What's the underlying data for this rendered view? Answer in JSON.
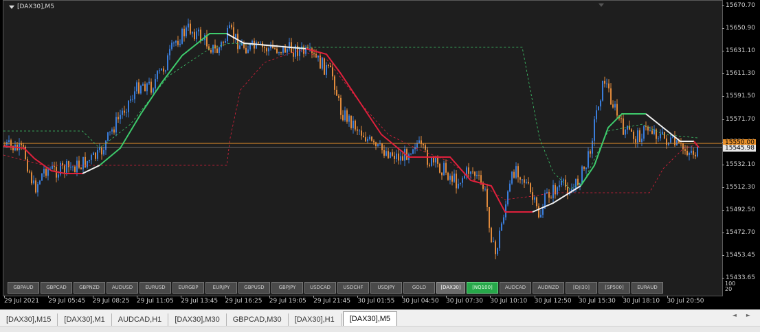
{
  "chart": {
    "symbol_label": "[DAX30],M5",
    "price_ticks": [
      "15670.70",
      "15650.90",
      "15631.10",
      "15611.30",
      "15591.50",
      "15571.70",
      "15551.90",
      "15532.10",
      "15512.30",
      "15492.50",
      "15472.70",
      "15453.45",
      "15433.65"
    ],
    "current_price": "15545.98",
    "orange_tag": "15550.00",
    "time_labels": [
      "29 Jul 2021",
      "29 Jul 05:45",
      "29 Jul 08:25",
      "29 Jul 11:05",
      "29 Jul 13:45",
      "29 Jul 16:25",
      "29 Jul 19:05",
      "29 Jul 21:45",
      "30 Jul 01:55",
      "30 Jul 04:50",
      "30 Jul 07:30",
      "30 Jul 10:10",
      "30 Jul 12:50",
      "30 Jul 15:30",
      "30 Jul 18:10",
      "30 Jul 20:50"
    ],
    "osc_levels": [
      "100",
      "20"
    ],
    "colors": {
      "background": "#1e1e1e",
      "bull_candle": "#3a7ddb",
      "bear_candle": "#e08a3c",
      "trend_up": "#3ecb6c",
      "trend_down": "#e0203c",
      "trend_flat": "#f0f0f0",
      "price_line": "#e8a040"
    }
  },
  "symbol_buttons": [
    {
      "label": "GBPAUD",
      "state": "normal"
    },
    {
      "label": "GBPCAD",
      "state": "normal"
    },
    {
      "label": "GBPNZD",
      "state": "normal"
    },
    {
      "label": "AUDUSD",
      "state": "normal"
    },
    {
      "label": "EURUSD",
      "state": "normal"
    },
    {
      "label": "EURGBP",
      "state": "normal"
    },
    {
      "label": "EURJPY",
      "state": "normal"
    },
    {
      "label": "GBPUSD",
      "state": "normal"
    },
    {
      "label": "GBPJPY",
      "state": "normal"
    },
    {
      "label": "USDCAD",
      "state": "normal"
    },
    {
      "label": "USDCHF",
      "state": "normal"
    },
    {
      "label": "USDJPY",
      "state": "normal"
    },
    {
      "label": "GOLD",
      "state": "normal"
    },
    {
      "label": "[DAX30]",
      "state": "active"
    },
    {
      "label": "[NQ100]",
      "state": "highlight"
    },
    {
      "label": "AUDCAD",
      "state": "normal"
    },
    {
      "label": "AUDNZD",
      "state": "normal"
    },
    {
      "label": "[DJI30]",
      "state": "normal"
    },
    {
      "label": "[SP500]",
      "state": "normal"
    },
    {
      "label": "EURAUD",
      "state": "normal"
    }
  ],
  "tabs": [
    {
      "label": "[DAX30],M15",
      "active": false
    },
    {
      "label": "[DAX30],M1",
      "active": false
    },
    {
      "label": "AUDCAD,H1",
      "active": false
    },
    {
      "label": "[DAX30],M30",
      "active": false
    },
    {
      "label": "GBPCAD,M30",
      "active": false
    },
    {
      "label": "[DAX30],H1",
      "active": false
    },
    {
      "label": "[DAX30],M5",
      "active": true
    }
  ],
  "tab_nav": {
    "left": "◄",
    "right": "►"
  }
}
